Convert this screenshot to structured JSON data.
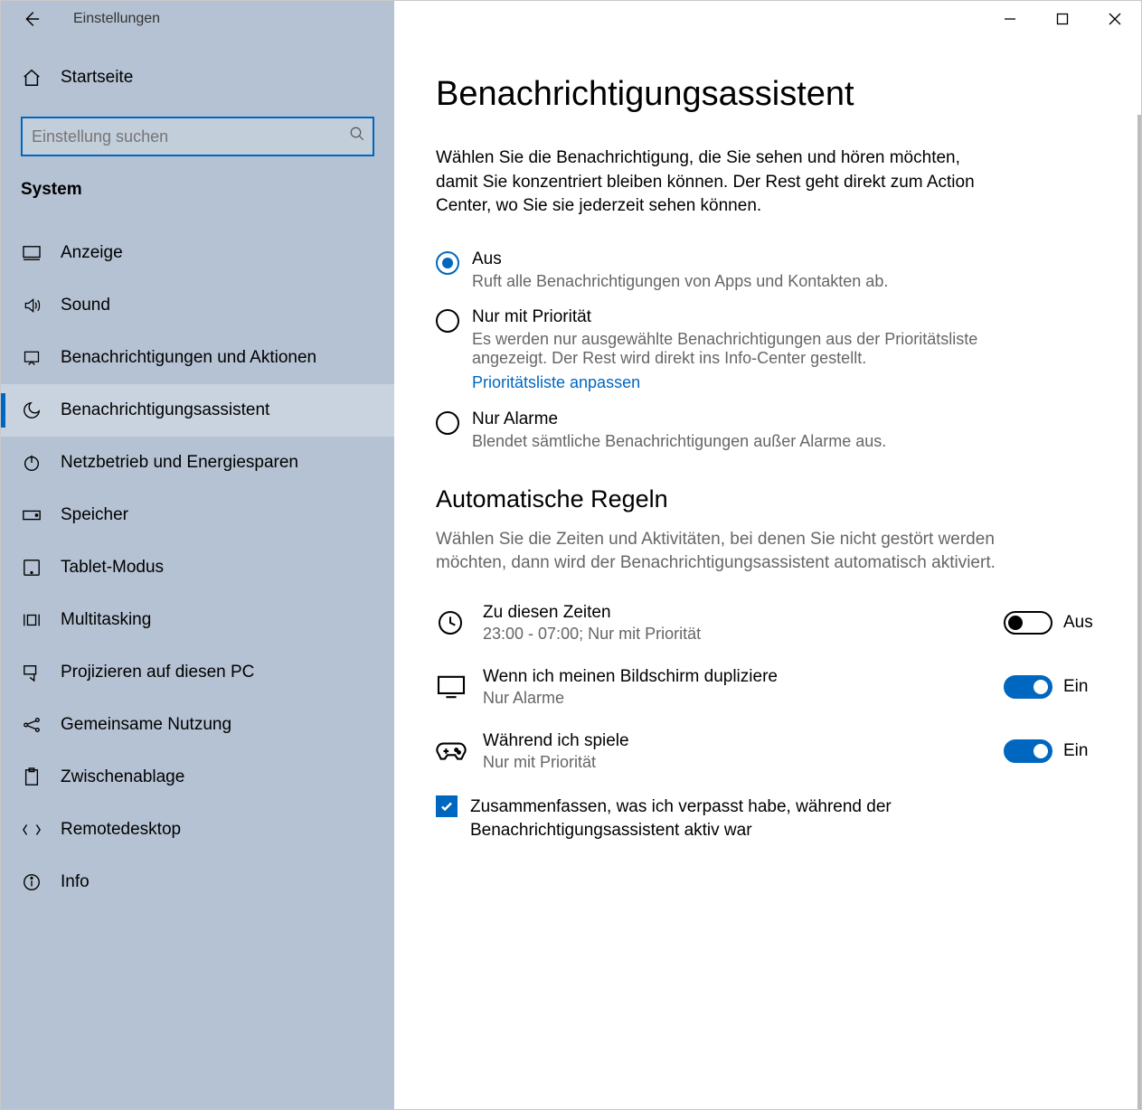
{
  "titlebar": {
    "title": "Einstellungen"
  },
  "sidebar": {
    "home": "Startseite",
    "search_placeholder": "Einstellung suchen",
    "group": "System",
    "items": [
      {
        "label": "Anzeige"
      },
      {
        "label": "Sound"
      },
      {
        "label": "Benachrichtigungen und Aktionen"
      },
      {
        "label": "Benachrichtigungsassistent"
      },
      {
        "label": "Netzbetrieb und Energiesparen"
      },
      {
        "label": "Speicher"
      },
      {
        "label": "Tablet-Modus"
      },
      {
        "label": "Multitasking"
      },
      {
        "label": "Projizieren auf diesen PC"
      },
      {
        "label": "Gemeinsame Nutzung"
      },
      {
        "label": "Zwischenablage"
      },
      {
        "label": "Remotedesktop"
      },
      {
        "label": "Info"
      }
    ]
  },
  "main": {
    "heading": "Benachrichtigungsassistent",
    "intro": "Wählen Sie die Benachrichtigung, die Sie sehen und hören möchten, damit Sie konzentriert bleiben können. Der Rest geht direkt zum Action Center, wo Sie sie jederzeit sehen können.",
    "options": {
      "off": {
        "title": "Aus",
        "desc": "Ruft alle Benachrichtigungen von Apps und Kontakten ab."
      },
      "priority": {
        "title": "Nur mit Priorität",
        "desc": "Es werden nur ausgewählte Benachrichtigungen aus der Prioritätsliste angezeigt. Der Rest wird direkt ins Info-Center gestellt.",
        "link": "Prioritätsliste anpassen"
      },
      "alarms": {
        "title": "Nur Alarme",
        "desc": "Blendet sämtliche Benachrichtigungen außer Alarme aus."
      }
    },
    "rules_heading": "Automatische Regeln",
    "rules_intro": "Wählen Sie die Zeiten und Aktivitäten, bei denen Sie nicht gestört werden möchten, dann wird der Benachrichtigungsassistent automatisch aktiviert.",
    "rules": {
      "times": {
        "title": "Zu diesen Zeiten",
        "sub": "23:00 - 07:00; Nur mit Priorität",
        "state": "Aus"
      },
      "duplicate": {
        "title": "Wenn ich meinen Bildschirm dupliziere",
        "sub": "Nur Alarme",
        "state": "Ein"
      },
      "gaming": {
        "title": "Während ich spiele",
        "sub": "Nur mit Priorität",
        "state": "Ein"
      }
    },
    "summary_checkbox": "Zusammenfassen, was ich verpasst habe, während der Benachrichtigungsassistent aktiv war"
  },
  "labels": {
    "on": "Ein",
    "off": "Aus"
  }
}
